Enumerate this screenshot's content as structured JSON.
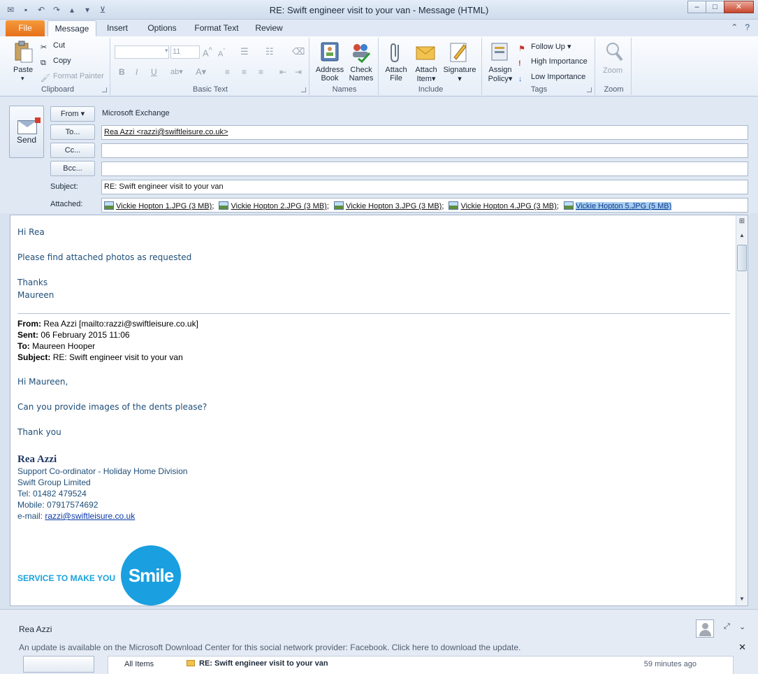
{
  "window": {
    "title": "RE: Swift engineer visit to your van  -  Message (HTML)",
    "minimize": "–",
    "maximize": "□",
    "close": "✕"
  },
  "tabs": [
    {
      "label": "File"
    },
    {
      "label": "Message"
    },
    {
      "label": "Insert"
    },
    {
      "label": "Options"
    },
    {
      "label": "Format Text"
    },
    {
      "label": "Review"
    }
  ],
  "ribbon": {
    "clipboard": {
      "label": "Clipboard",
      "paste": "Paste",
      "cut": "Cut",
      "copy": "Copy",
      "format_painter": "Format Painter"
    },
    "basic_text": {
      "label": "Basic Text",
      "font_size": "11",
      "bold": "B",
      "italic": "I",
      "underline": "U"
    },
    "names": {
      "label": "Names",
      "address_book_1": "Address",
      "address_book_2": "Book",
      "check_names_1": "Check",
      "check_names_2": "Names"
    },
    "include": {
      "label": "Include",
      "attach_file_1": "Attach",
      "attach_file_2": "File",
      "attach_item_1": "Attach",
      "attach_item_2": "Item",
      "signature": "Signature"
    },
    "tags": {
      "label": "Tags",
      "assign_policy_1": "Assign",
      "assign_policy_2": "Policy",
      "follow_up": "Follow Up",
      "high_importance": "High Importance",
      "low_importance": "Low Importance"
    },
    "zoom": {
      "label": "Zoom",
      "zoom": "Zoom"
    }
  },
  "header": {
    "send": "Send",
    "from_btn": "From",
    "from_value": "Microsoft Exchange",
    "to_btn": "To...",
    "to_value": "Rea Azzi <razzi@swiftleisure.co.uk>",
    "cc_btn": "Cc...",
    "cc_value": "",
    "bcc_btn": "Bcc...",
    "bcc_value": "",
    "subject_label": "Subject:",
    "subject_value": "RE: Swift engineer visit to your van",
    "attached_label": "Attached:",
    "attachments": [
      {
        "name": "Vickie Hopton 1.JPG (3 MB)",
        "sep": ";"
      },
      {
        "name": "Vickie Hopton 2.JPG (3 MB)",
        "sep": ";"
      },
      {
        "name": "Vickie Hopton 3.JPG (3 MB)",
        "sep": ";"
      },
      {
        "name": "Vickie Hopton 4.JPG (3 MB)",
        "sep": ";"
      },
      {
        "name": "Vickie Hopton 5.JPG (5 MB)",
        "sep": ""
      }
    ]
  },
  "body": {
    "greeting": "Hi Rea",
    "line1": "Please find attached photos as requested",
    "thanks": "Thanks",
    "sender": "Maureen",
    "quoted": {
      "from_label": "From:",
      "from_value": "Rea Azzi [mailto:razzi@swiftleisure.co.uk]",
      "sent_label": "Sent:",
      "sent_value": "06 February 2015 11:06",
      "to_label": "To:",
      "to_value": "Maureen Hooper",
      "subject_label": "Subject:",
      "subject_value": "RE: Swift engineer visit to your van",
      "greeting": "Hi Maureen,",
      "line1": "Can you provide images of the dents please?",
      "thanks": "Thank you"
    },
    "signature": {
      "name": "Rea Azzi",
      "role": "Support Co-ordinator - Holiday Home Division",
      "company": "Swift Group Limited",
      "tel": "Tel: 01482 479524",
      "mobile": "Mobile: 07917574692",
      "email_label": "e-mail: ",
      "email": "razzi@swiftleisure.co.uk"
    },
    "logo": {
      "tagline": "SERVICE TO MAKE YOU",
      "word": "Smile"
    }
  },
  "people_pane": {
    "name": "Rea Azzi",
    "notification": "An update is available on the Microsoft Download Center for this social network provider: Facebook. Click here to download the update.",
    "list_filter": "All Items",
    "list_subject": "RE: Swift engineer visit to your van",
    "list_time": "59 minutes ago"
  },
  "colors": {
    "file_tab": "#e6701a",
    "body_text": "#1f4e79",
    "logo_blue": "#1a9fe0"
  }
}
